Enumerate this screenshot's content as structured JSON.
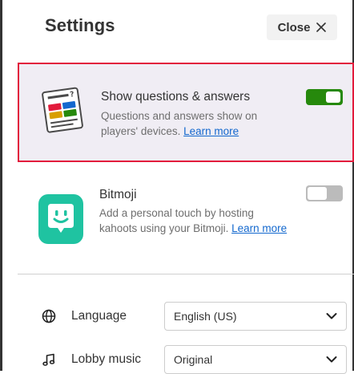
{
  "header": {
    "title": "Settings",
    "close_label": "Close"
  },
  "settings": [
    {
      "title": "Show questions & answers",
      "description": "Questions and answers show on players' devices.",
      "link": "Learn more",
      "enabled": true,
      "highlighted": true,
      "icon": "question-answer-icon"
    },
    {
      "title": "Bitmoji",
      "description": "Add a personal touch by hosting kahoots using your Bitmoji.",
      "link": "Learn more",
      "enabled": false,
      "highlighted": false,
      "icon": "bitmoji-icon"
    }
  ],
  "language": {
    "label": "Language",
    "value": "English (US)",
    "icon": "globe-icon"
  },
  "lobby_music": {
    "label": "Lobby music",
    "value": "Original",
    "icon": "music-note-icon"
  },
  "colors": {
    "highlight_border": "#e21b3c",
    "highlight_bg": "#f0edf4",
    "toggle_on": "#26890c",
    "toggle_off": "#bbbbbb",
    "link": "#1368ce",
    "bitmoji_bg": "#1fc3a1"
  }
}
